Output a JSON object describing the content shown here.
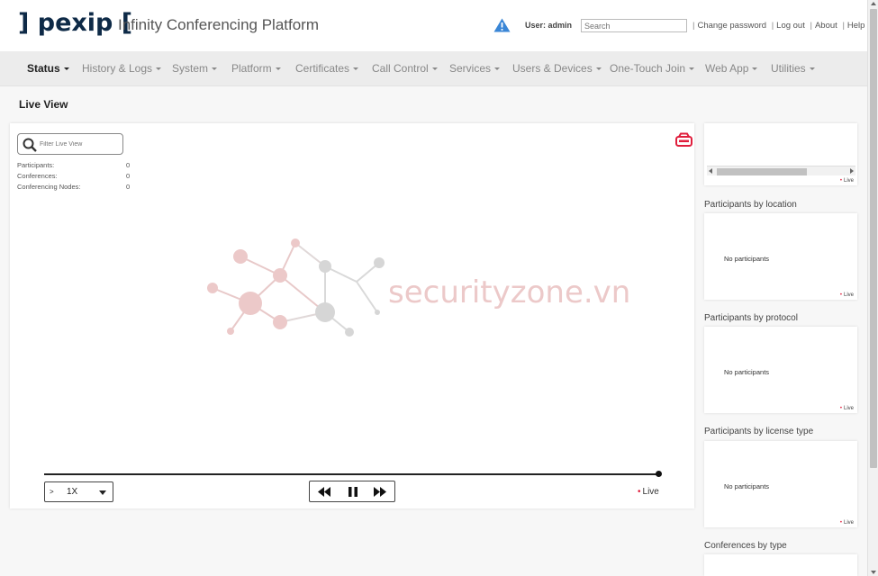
{
  "header": {
    "logo": "] pexip [",
    "app_title": "Infinity Conferencing Platform",
    "warning_icon": "warning-triangle-icon",
    "user_label": "User: admin",
    "search_placeholder": "Search",
    "links": [
      "Change password",
      "Log out",
      "About",
      "Help"
    ]
  },
  "nav": {
    "items": [
      {
        "label": "Status",
        "active": true
      },
      {
        "label": "History & Logs"
      },
      {
        "label": "System"
      },
      {
        "label": "Platform"
      },
      {
        "label": "Certificates"
      },
      {
        "label": "Call Control"
      },
      {
        "label": "Services"
      },
      {
        "label": "Users & Devices"
      },
      {
        "label": "One-Touch Join"
      },
      {
        "label": "Web App"
      },
      {
        "label": "Utilities"
      }
    ]
  },
  "page": {
    "title": "Live View"
  },
  "live_view": {
    "filter_placeholder": "Filter Live View",
    "stats": [
      {
        "label": "Participants:",
        "value": "0"
      },
      {
        "label": "Conferences:",
        "value": "0"
      },
      {
        "label": "Conferencing Nodes:",
        "value": "0"
      }
    ],
    "watermark_text": "securityzone.vn",
    "playback": {
      "prefix": ">",
      "speed": "1X",
      "live_label": "Live"
    }
  },
  "side": {
    "live_label": "Live",
    "sections": [
      {
        "title": "Participants by location",
        "empty": "No participants"
      },
      {
        "title": "Participants by protocol",
        "empty": "No participants"
      },
      {
        "title": "Participants by license type",
        "empty": "No participants"
      },
      {
        "title": "Conferences by type"
      }
    ]
  },
  "colors": {
    "accent_red": "#e01f3d",
    "brand_navy": "#0e2a47",
    "warning_blue": "#3a86d6"
  }
}
